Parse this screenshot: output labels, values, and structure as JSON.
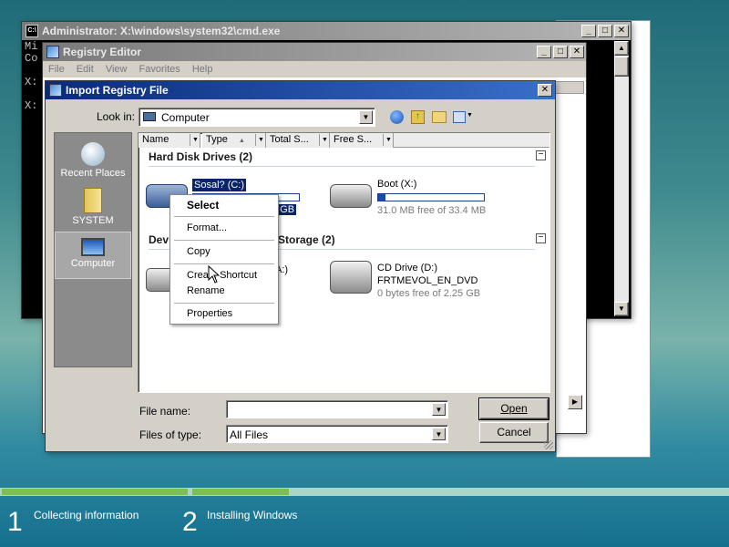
{
  "cmd": {
    "title": "Administrator: X:\\windows\\system32\\cmd.exe",
    "visible_lines": [
      "Mi",
      "Co",
      "X:",
      "X:"
    ]
  },
  "regedit": {
    "title": "Registry Editor",
    "menu": [
      "File",
      "Edit",
      "View",
      "Favorites",
      "Help"
    ]
  },
  "dialog": {
    "title": "Import Registry File",
    "look_in_label": "Look in:",
    "look_in_value": "Computer",
    "toolbar_icons": [
      "back-icon",
      "up-folder-icon",
      "new-folder-icon",
      "views-menu-icon"
    ],
    "places": [
      {
        "label": "Recent Places",
        "icon": "recent-places-icon"
      },
      {
        "label": "SYSTEM",
        "icon": "user-folder-icon"
      },
      {
        "label": "Computer",
        "icon": "computer-icon"
      }
    ],
    "columns": [
      "Name",
      "Type",
      "Total S...",
      "Free S..."
    ],
    "groups": {
      "hdd": {
        "title": "Hard Disk Drives (2)",
        "collapse": "−"
      },
      "removable": {
        "title_start": "Dev",
        "title_end": "Storage (2)",
        "collapse": "−"
      }
    },
    "drives": {
      "c": {
        "name": "Sosal? (C:)",
        "size_tail": "9 GB",
        "fill": 0.5
      },
      "x": {
        "name": "Boot (X:)",
        "size": "31.0 MB free of 33.4 MB",
        "fill": 0.07
      },
      "a": {
        "name_tail": "A:)"
      },
      "d": {
        "name": "CD Drive (D:)",
        "label": "FRTMEVOL_EN_DVD",
        "size": "0 bytes free of 2.25 GB"
      }
    },
    "file_name_label": "File name:",
    "file_name_value": "",
    "file_type_label": "Files of type:",
    "file_type_value": "All Files",
    "open_btn": "Open",
    "cancel_btn": "Cancel"
  },
  "context_menu": {
    "items": [
      "Select",
      "Format...",
      "Copy",
      "Create Shortcut",
      "Rename",
      "Properties"
    ]
  },
  "setup": {
    "steps": [
      {
        "number": "1",
        "label": "Collecting information"
      },
      {
        "number": "2",
        "label": "Installing Windows"
      }
    ],
    "step1_progress": 1.0,
    "step2_progress": 0.18
  }
}
